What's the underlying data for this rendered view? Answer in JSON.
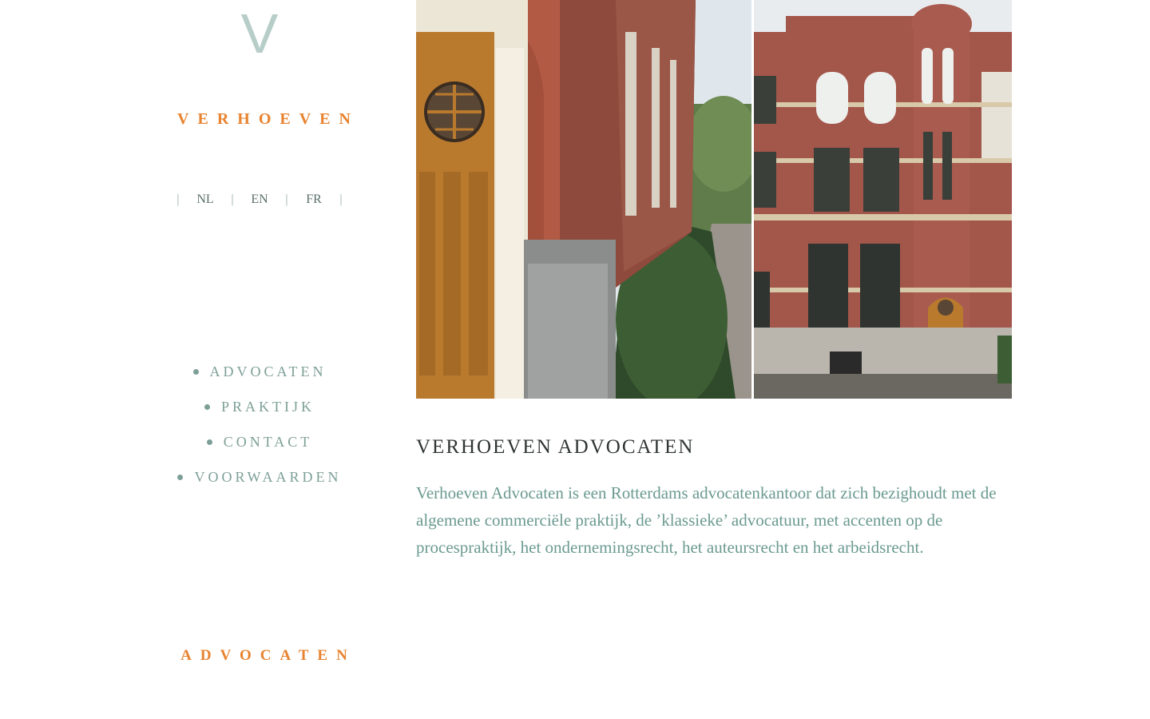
{
  "sidebar": {
    "monogram": "V",
    "brand": "VERHOEVEN",
    "languages": [
      "NL",
      "EN",
      "FR"
    ],
    "nav": [
      {
        "label": "ADVOCATEN"
      },
      {
        "label": "PRAKTIJK"
      },
      {
        "label": "CONTACT"
      },
      {
        "label": "VOORWAARDEN"
      }
    ],
    "footer_tag": "ADVOCATEN"
  },
  "main": {
    "title": "VERHOEVEN ADVOCATEN",
    "body": "Verhoeven Advocaten is een Rotterdams advocatenkantoor dat zich bezighoudt met de algemene commerciële praktijk, de ’klassieke’ advocatuur, met accenten op de procespraktijk, het ondernemingsrecht, het auteursrecht en het arbeidsrecht."
  },
  "colors": {
    "accent_orange": "#e8832f",
    "nav_teal": "#7d9f97",
    "text_teal": "#6b9a90",
    "monogram": "#b7cdc7",
    "heading": "#2f3533"
  },
  "images": {
    "left": "building-entrance-door-photo",
    "right": "building-facade-photo"
  }
}
